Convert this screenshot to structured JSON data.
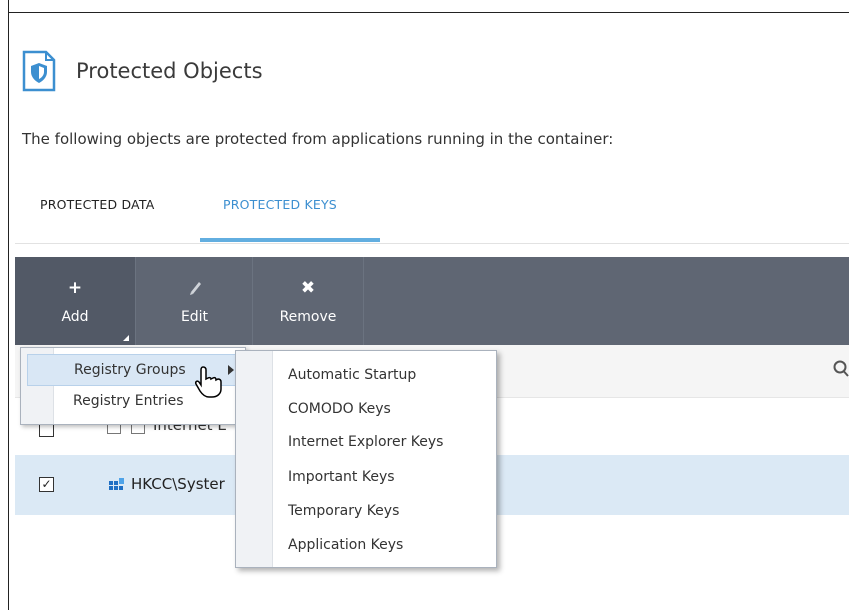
{
  "header": {
    "title": "Protected Objects",
    "icon": "shield-document-icon"
  },
  "description": "The following objects are protected from applications running in the container:",
  "tabs": [
    {
      "label": "PROTECTED DATA",
      "active": false
    },
    {
      "label": "PROTECTED KEYS",
      "active": true
    }
  ],
  "toolbar": {
    "add": {
      "label": "Add",
      "icon": "plus-icon"
    },
    "edit": {
      "label": "Edit",
      "icon": "pencil-icon"
    },
    "remove": {
      "label": "Remove",
      "icon": "x-icon"
    }
  },
  "add_menu": {
    "items": [
      {
        "label": "Registry Groups",
        "highlighted": true,
        "has_submenu": true
      },
      {
        "label": "Registry Entries",
        "highlighted": false
      }
    ]
  },
  "groups_submenu": {
    "items": [
      "Automatic Startup",
      "COMODO Keys",
      "Internet Explorer Keys",
      "Important Keys",
      "Temporary Keys",
      "Application Keys"
    ]
  },
  "list": {
    "rows": [
      {
        "text": "Internet E",
        "checked": false
      },
      {
        "text": "HKCC\\Syster",
        "checked": true
      }
    ]
  },
  "colors": {
    "accent": "#3c8fd0",
    "toolbar_bg": "#5f6673",
    "selected_row": "#dbe9f5"
  }
}
